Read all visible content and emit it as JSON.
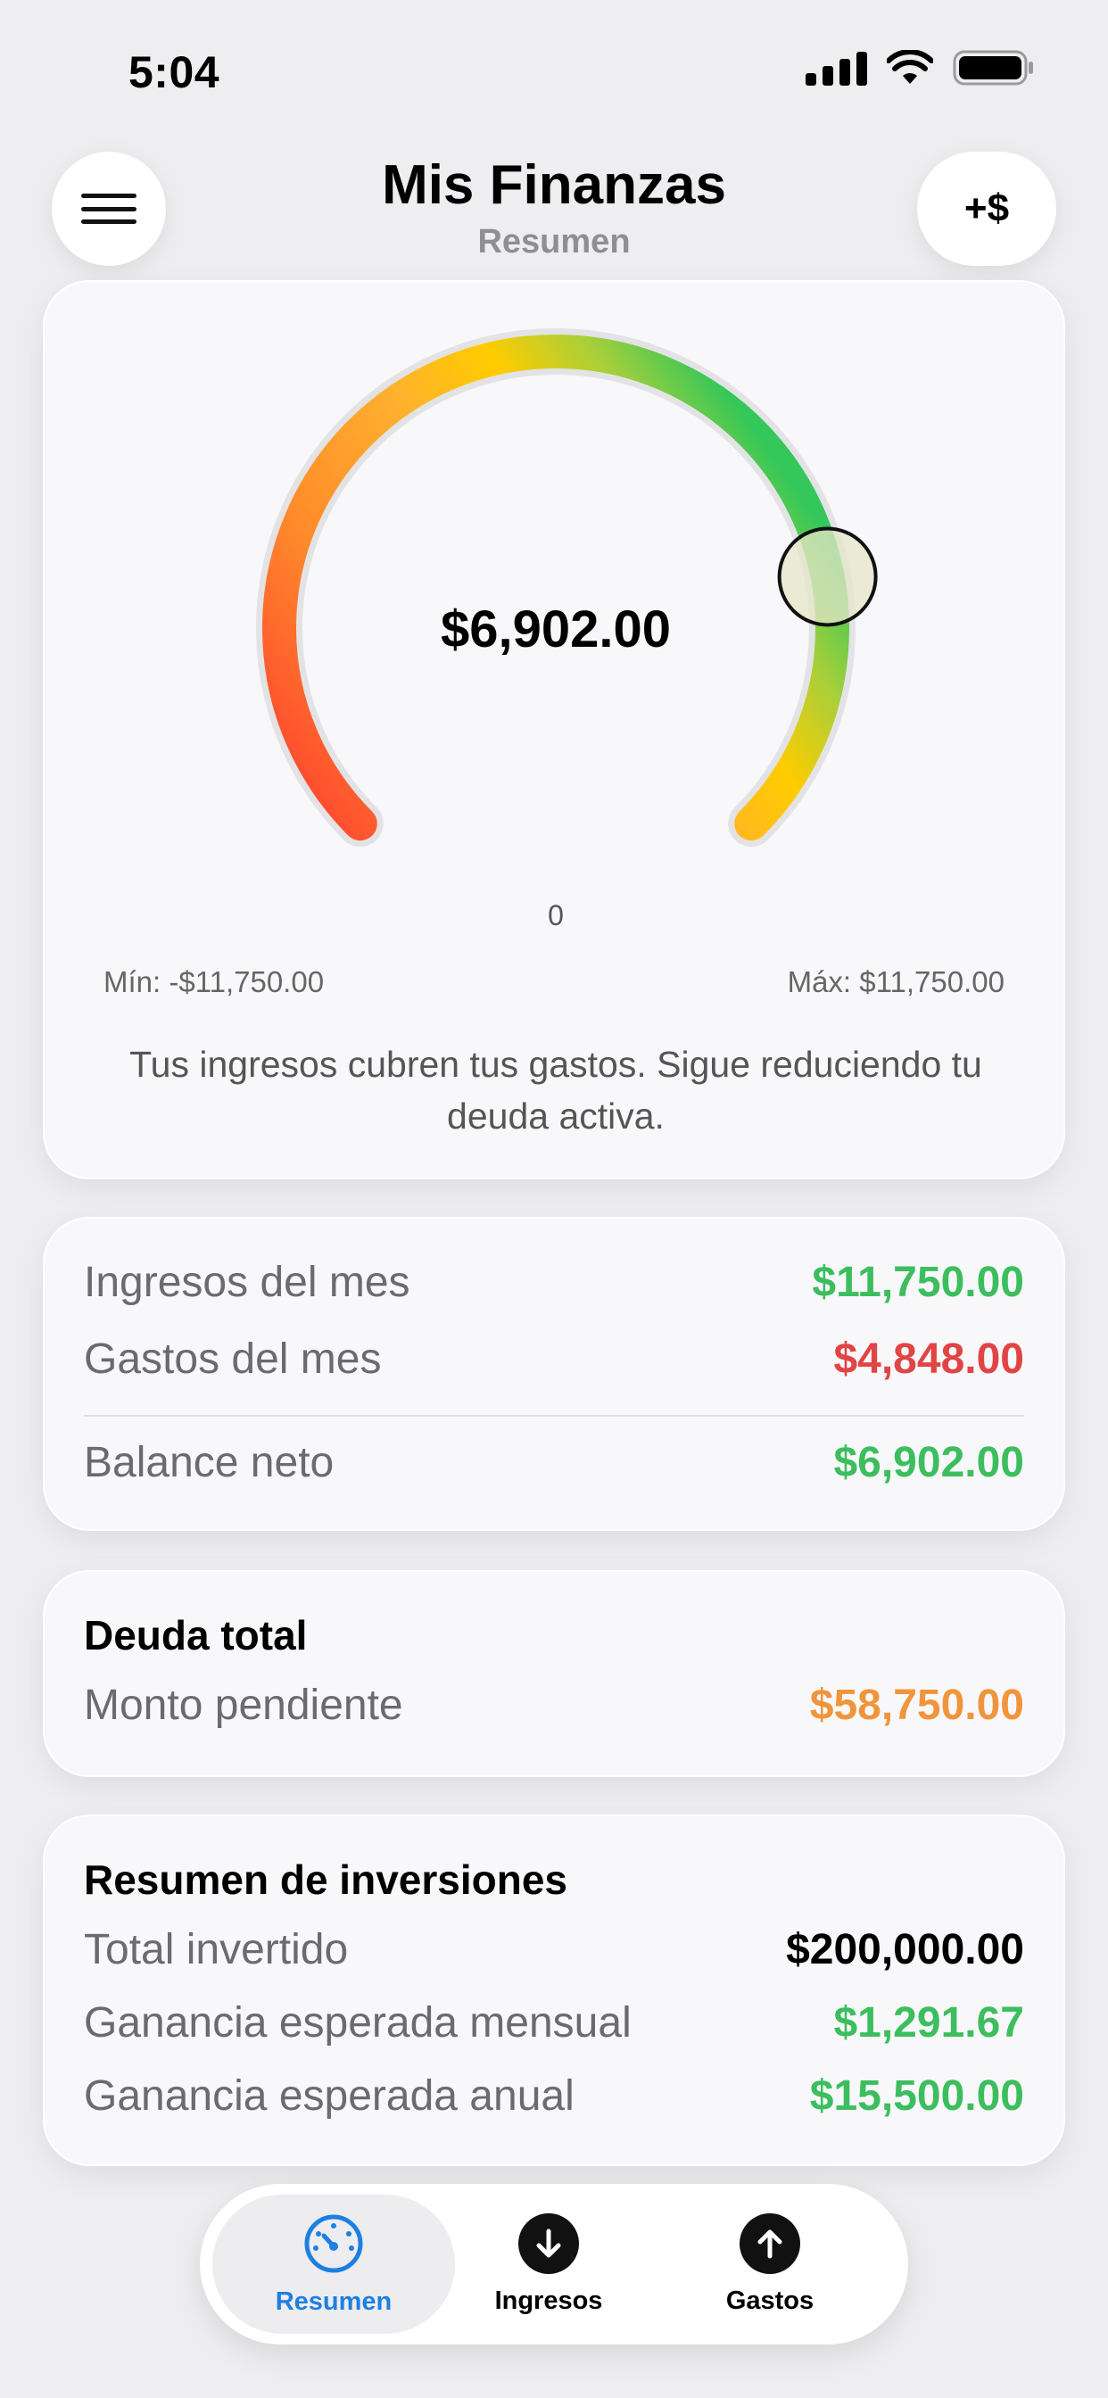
{
  "status_bar": {
    "time": "5:04",
    "icons": [
      "cellular-signal-icon",
      "wifi-icon",
      "battery-icon"
    ]
  },
  "header": {
    "title": "Mis Finanzas",
    "subtitle": "Resumen",
    "menu_icon": "hamburger-menu-icon",
    "add_button_label": "+$"
  },
  "gauge": {
    "value_label": "$6,902.00",
    "value": 6902,
    "min": -11750,
    "max": 11750,
    "center_label": "0",
    "min_label": "Mín: -$11,750.00",
    "max_label": "Máx: $11,750.00",
    "message": "Tus ingresos cubren tus gastos. Sigue reduciendo tu deuda activa.",
    "colors": [
      "#FF3B30",
      "#FF8A2A",
      "#FFB02E",
      "#FFCC00",
      "#A8CF3A",
      "#34C759"
    ]
  },
  "monthly": {
    "income_label": "Ingresos del mes",
    "income_value": "$11,750.00",
    "expenses_label": "Gastos del mes",
    "expenses_value": "$4,848.00",
    "balance_label": "Balance neto",
    "balance_value": "$6,902.00"
  },
  "debt": {
    "title": "Deuda total",
    "pending_label": "Monto pendiente",
    "pending_value": "$58,750.00"
  },
  "investments": {
    "title": "Resumen de inversiones",
    "total_label": "Total invertido",
    "total_value": "$200,000.00",
    "monthly_label": "Ganancia esperada mensual",
    "monthly_value": "$1,291.67",
    "annual_label": "Ganancia esperada anual",
    "annual_value": "$15,500.00"
  },
  "tabbar": {
    "tabs": [
      {
        "label": "Resumen",
        "icon": "gauge-icon",
        "active": true
      },
      {
        "label": "Ingresos",
        "icon": "arrow-down-circle-icon",
        "active": false
      },
      {
        "label": "Gastos",
        "icon": "arrow-up-circle-icon",
        "active": false
      }
    ]
  },
  "colors": {
    "positive": "#3DBE5E",
    "negative": "#E04545",
    "debt": "#F0953C",
    "accent": "#1E7FE0"
  }
}
